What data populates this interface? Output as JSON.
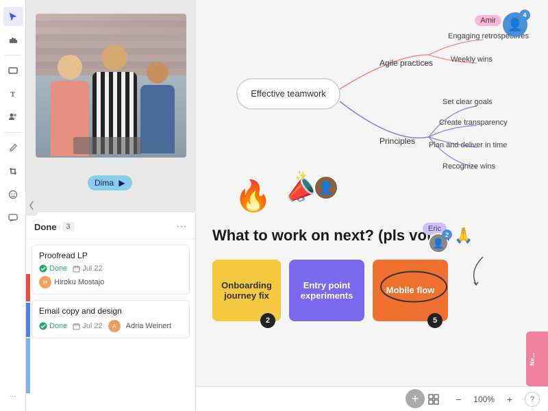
{
  "sidebar": {
    "icons": [
      "cursor",
      "hand",
      "rectangle",
      "text",
      "users",
      "pen",
      "crop",
      "smile",
      "chat",
      "more"
    ]
  },
  "photo": {
    "dima_label": "Dima"
  },
  "mindmap": {
    "center_node": "Effective teamwork",
    "branches": {
      "agile": {
        "label": "Agile practices",
        "children": [
          "Engaging retrospectives",
          "Weekly wins"
        ]
      },
      "principles": {
        "label": "Principles",
        "children": [
          "Set clear goals",
          "Create transparency",
          "Plan and deliver in time",
          "Recognize wins"
        ]
      }
    }
  },
  "amir": {
    "label": "Amir",
    "badge": "4"
  },
  "tasks": {
    "status": "Done",
    "count": "3",
    "more_icon": "···",
    "cards": [
      {
        "title": "Proofread LP",
        "status": "Done",
        "date": "Jul 22",
        "assignee": "Hiroku Mostajo"
      },
      {
        "title": "Email copy and design",
        "status": "Done",
        "date": "Jul 22",
        "assignee": "Adria Weinert"
      }
    ]
  },
  "vote_section": {
    "title": "What to work on next?\n(pls vote!) 🙏",
    "cards": [
      {
        "label": "Onboarding journey fix",
        "color": "yellow",
        "badge": "2"
      },
      {
        "label": "Entry point experiments",
        "color": "purple",
        "badge": ""
      },
      {
        "label": "Mobile flow",
        "color": "orange",
        "badge": "5"
      }
    ],
    "eric_label": "Eric",
    "user2_badge": "2"
  },
  "toolbar": {
    "zoom": "100%",
    "add_btn": "+",
    "crop_icon": "⊞",
    "minus_icon": "−",
    "plus_icon": "+",
    "help_icon": "?"
  },
  "emojis": {
    "fire": "🔥",
    "megaphone": "📣",
    "sparkles": "✨"
  }
}
